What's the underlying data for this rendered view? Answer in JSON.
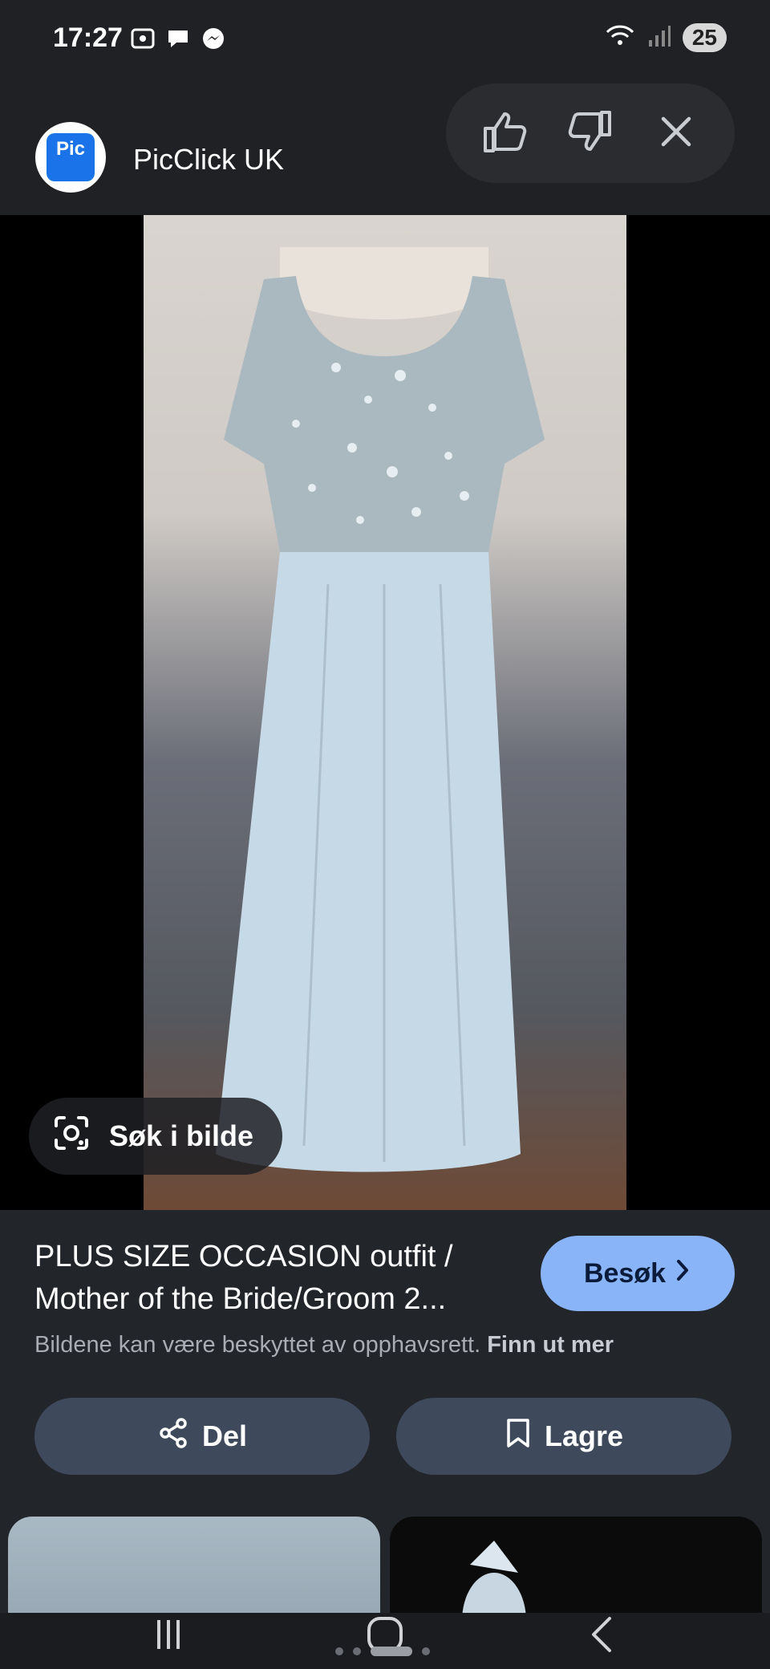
{
  "status_bar": {
    "time": "17:27",
    "battery": "25",
    "icons": [
      "screenshot-icon",
      "chat-bubble-icon",
      "messenger-icon",
      "wifi-icon",
      "signal-icon"
    ]
  },
  "header": {
    "logo_text": "Pic",
    "site_name": "PicClick UK",
    "feedback": [
      "thumbs-up-icon",
      "thumbs-down-icon",
      "close-icon"
    ]
  },
  "image": {
    "lens_label": "Søk i bilde"
  },
  "result": {
    "title_line1": "PLUS SIZE OCCASION outfit /",
    "title_line2": "Mother of the Bride/Groom 2...",
    "visit_label": "Besøk",
    "copyright_text": "Bildene kan være beskyttet av opphavsrett.",
    "learn_more": "Finn ut mer",
    "share_label": "Del",
    "save_label": "Lagre"
  },
  "colors": {
    "accent": "#8ab4f8",
    "button_bg": "#3e4a5c",
    "background": "#1f2125"
  }
}
